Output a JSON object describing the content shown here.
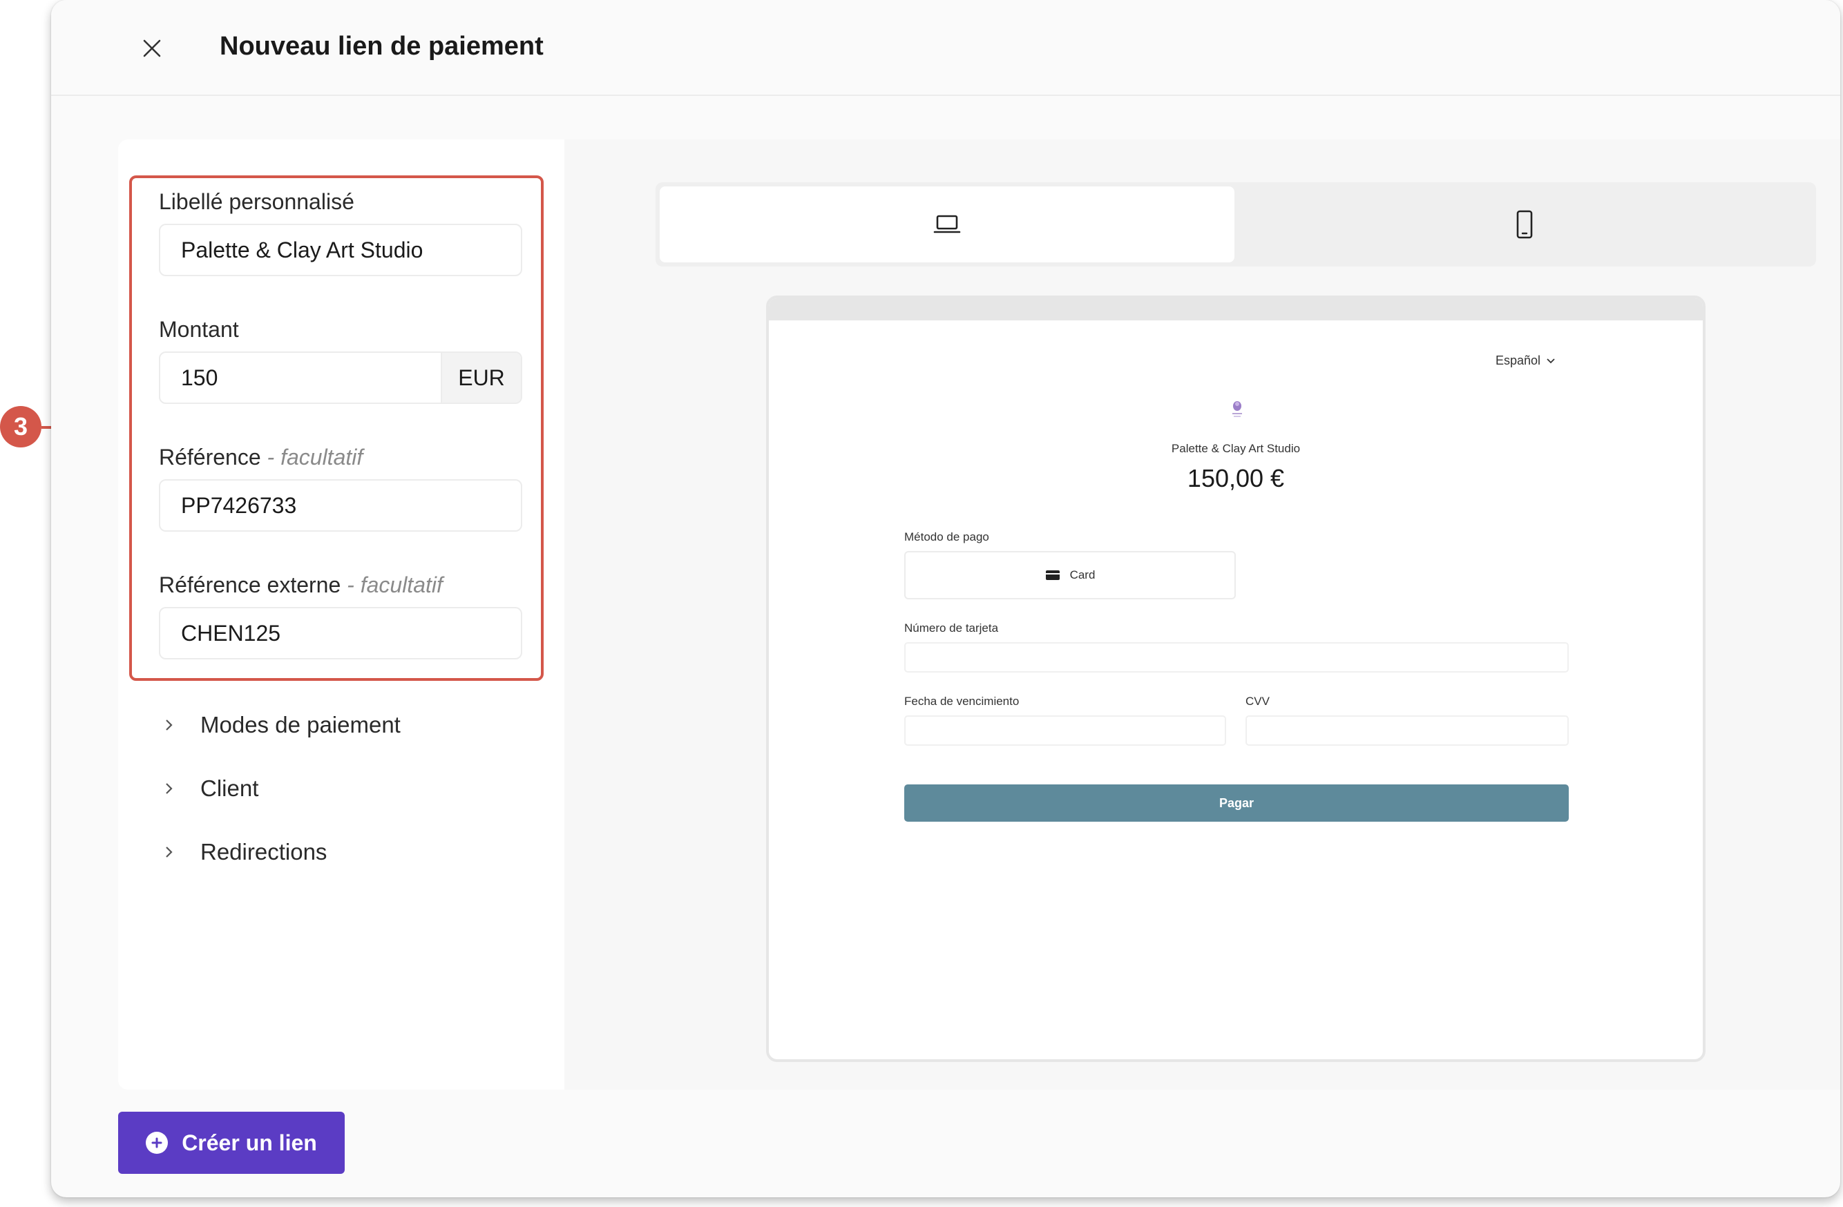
{
  "annotation": {
    "step_number": "3"
  },
  "modal": {
    "title": "Nouveau lien de paiement"
  },
  "form": {
    "label_field": {
      "label": "Libellé personnalisé",
      "value": "Palette & Clay Art Studio"
    },
    "amount_field": {
      "label": "Montant",
      "value": "150",
      "currency": "EUR"
    },
    "reference_field": {
      "label": "Référence",
      "optional": "- facultatif",
      "value": "PP7426733"
    },
    "external_reference_field": {
      "label": "Référence externe",
      "optional": "- facultatif",
      "value": "CHEN125"
    }
  },
  "accordions": [
    {
      "label": "Modes de paiement"
    },
    {
      "label": "Client"
    },
    {
      "label": "Redirections"
    }
  ],
  "device_toggle": {
    "active": "desktop",
    "options": [
      "laptop-icon",
      "mobile-icon"
    ]
  },
  "preview": {
    "language": "Español",
    "merchant_name": "Palette & Clay Art Studio",
    "amount": "150,00 €",
    "method_label": "Método de pago",
    "method_option": "Card",
    "card_number_label": "Número de tarjeta",
    "expiry_label": "Fecha de vencimiento",
    "cvv_label": "CVV",
    "pay_button": "Pagar"
  },
  "actions": {
    "create_link": "Créer un lien"
  },
  "colors": {
    "accent": "#5b3cc4",
    "highlight": "#d4574a",
    "pay_button": "#5e8a9b"
  }
}
